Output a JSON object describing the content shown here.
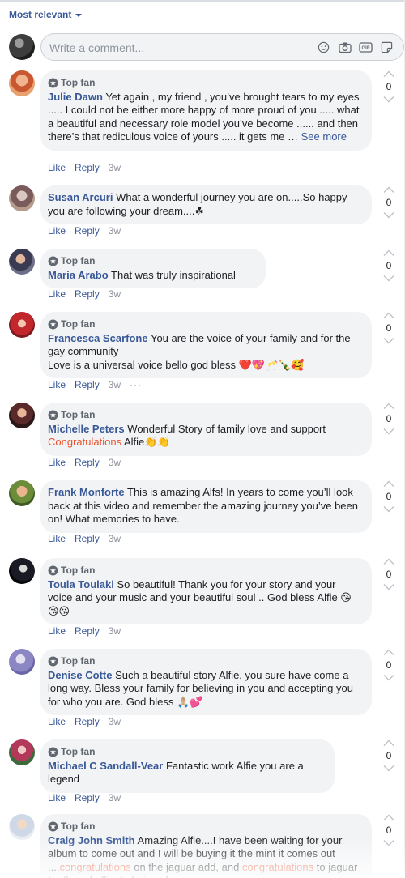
{
  "sort": {
    "label": "Most relevant"
  },
  "composer": {
    "placeholder": "Write a comment...",
    "icons": [
      "emoji-icon",
      "camera-icon",
      "gif-icon",
      "sticker-icon"
    ]
  },
  "common": {
    "like": "Like",
    "reply": "Reply",
    "top_fan": "Top fan",
    "see_more": "See more",
    "more_options": "···"
  },
  "colors": {
    "link": "#385898",
    "bubble": "#f2f3f5",
    "highlight": "#e9522e",
    "meta": "#90949c"
  },
  "comments": [
    {
      "author": "Julie Dawn",
      "top_fan": true,
      "text": "Yet again , my friend , you’ve brought tears to my eyes ..... I could not be either more happy of more proud of you ..... what a beautiful and necessary role model you’ve become ...... and then there’s that rediculous voice of yours ..... it gets me … ",
      "see_more": true,
      "time": "3w",
      "votes": "0"
    },
    {
      "author": "Susan Arcuri",
      "top_fan": false,
      "text": "What a wonderful journey you are on.....So happy you are following your dream....☘",
      "time": "3w",
      "votes": "0"
    },
    {
      "author": "Maria Arabo",
      "top_fan": true,
      "text": "That was truly inspirational",
      "time": "3w",
      "votes": "0"
    },
    {
      "author": "Francesca Scarfone",
      "top_fan": true,
      "text": "You are the voice of your family and for the gay community",
      "text2": "Love is a universal voice bello god bless ❤️💖🥂🍾🥰",
      "time": "3w",
      "votes": "0",
      "has_more": true
    },
    {
      "author": "Michelle Peters",
      "top_fan": true,
      "text": "Wonderful Story of family love and support ",
      "highlight": "Congratulations",
      "text_after": " Alfie👏👏",
      "time": "3w",
      "votes": "0"
    },
    {
      "author": "Frank Monforte",
      "top_fan": false,
      "text": "This is amazing Alfs! In years to come you’ll look back at this video and remember the amazing journey you’ve been on! What memories to have.",
      "time": "3w",
      "votes": "0"
    },
    {
      "author": "Toula Toulaki",
      "top_fan": true,
      "text": "So beautiful! Thank you for your story and your voice and your music and your beautiful soul .. God bless Alfie 😘😘😘",
      "time": "3w",
      "votes": "0"
    },
    {
      "author": "Denise Cotte",
      "top_fan": true,
      "text": "Such a beautiful story Alfie, you sure have come a long way. Bless your family for believing in you and accepting you for who you are. God bless 🙏🏼💕",
      "time": "3w",
      "votes": "0"
    },
    {
      "author": "Michael C Sandall-Vear",
      "top_fan": true,
      "text": "Fantastic work Alfie you are a legend",
      "time": "3w",
      "votes": "0"
    },
    {
      "author": "Craig John Smith",
      "top_fan": true,
      "text": "Amazing Alfie....I have been waiting for your album to come out and I will be buying it the mint it comes out ....",
      "highlight": "congratulations",
      "text_after": " on the jaguar add, and ",
      "highlight2": "congratulations",
      "text_after2": " to jaguar for there brilliant choice of a",
      "votes": "0"
    }
  ]
}
